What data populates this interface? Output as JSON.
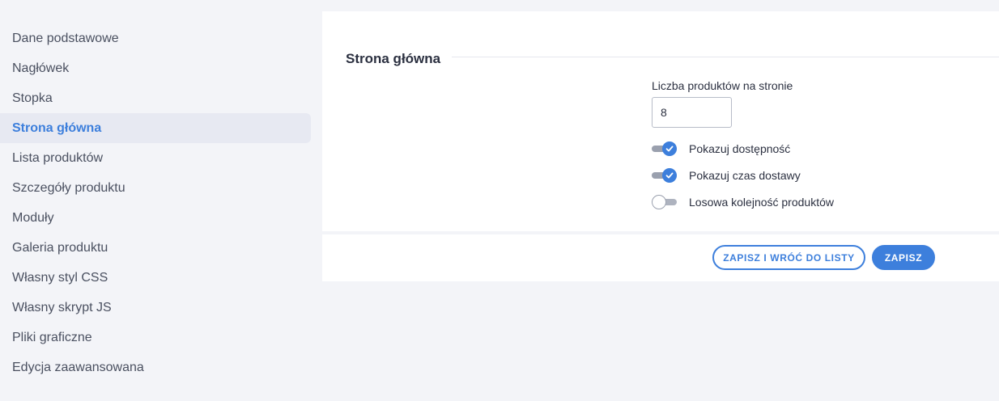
{
  "sidebar": {
    "items": [
      {
        "label": "Dane podstawowe"
      },
      {
        "label": "Nagłówek"
      },
      {
        "label": "Stopka"
      },
      {
        "label": "Strona główna",
        "active": true
      },
      {
        "label": "Lista produktów"
      },
      {
        "label": "Szczegóły produktu"
      },
      {
        "label": "Moduły"
      },
      {
        "label": "Galeria produktu"
      },
      {
        "label": "Własny styl CSS"
      },
      {
        "label": "Własny skrypt JS"
      },
      {
        "label": "Pliki graficzne"
      },
      {
        "label": "Edycja zaawansowana"
      }
    ]
  },
  "main": {
    "section_title": "Strona główna",
    "products_per_page": {
      "label": "Liczba produktów na stronie",
      "value": "8"
    },
    "toggles": [
      {
        "label": "Pokazuj dostępność",
        "checked": true
      },
      {
        "label": "Pokazuj czas dostawy",
        "checked": true
      },
      {
        "label": "Losowa kolejność produktów",
        "checked": false
      }
    ]
  },
  "actions": {
    "save_and_back_label": "ZAPISZ I WRÓĆ DO LISTY",
    "save_label": "ZAPISZ"
  },
  "colors": {
    "accent": "#3d7fdc",
    "background": "#f3f4f8",
    "active_item_bg": "#e7e9f2"
  }
}
